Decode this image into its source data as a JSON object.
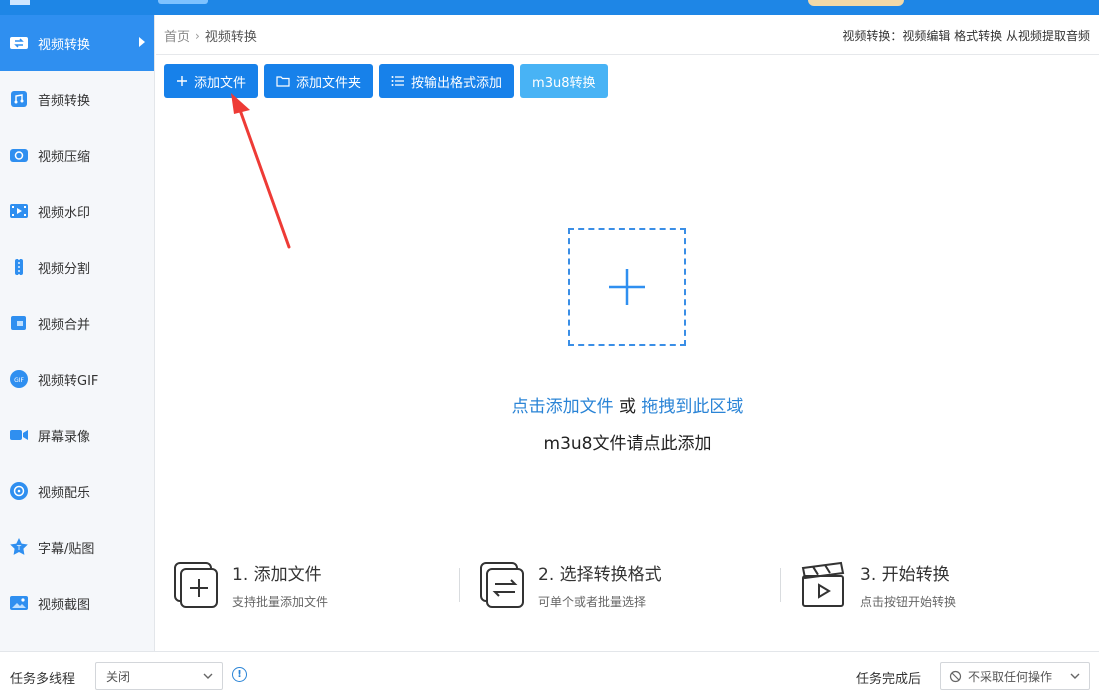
{
  "breadcrumb": {
    "home": "首页",
    "current": "视频转换"
  },
  "header_right": "视频转换：视频编辑 格式转换 从视频提取音频",
  "sidebar": {
    "items": [
      {
        "label": "视频转换",
        "icon": "video-convert-icon",
        "active": true
      },
      {
        "label": "音频转换",
        "icon": "audio-convert-icon"
      },
      {
        "label": "视频压缩",
        "icon": "video-compress-icon"
      },
      {
        "label": "视频水印",
        "icon": "video-watermark-icon"
      },
      {
        "label": "视频分割",
        "icon": "video-split-icon"
      },
      {
        "label": "视频合并",
        "icon": "video-merge-icon"
      },
      {
        "label": "视频转GIF",
        "icon": "video-gif-icon"
      },
      {
        "label": "屏幕录像",
        "icon": "screen-record-icon"
      },
      {
        "label": "视频配乐",
        "icon": "video-music-icon"
      },
      {
        "label": "字幕/贴图",
        "icon": "subtitle-sticker-icon"
      },
      {
        "label": "视频截图",
        "icon": "video-screenshot-icon"
      }
    ]
  },
  "toolbar": {
    "add_file": "添加文件",
    "add_folder": "添加文件夹",
    "add_by_format": "按输出格式添加",
    "m3u8": "m3u8转换"
  },
  "dropzone": {
    "click_add": "点击添加文件",
    "or": " 或 ",
    "drag_here": "拖拽到此区域",
    "m3u8_hint": "m3u8文件请点此添加"
  },
  "steps": [
    {
      "title": "1. 添加文件",
      "desc": "支持批量添加文件"
    },
    {
      "title": "2. 选择转换格式",
      "desc": "可单个或者批量选择"
    },
    {
      "title": "3. 开始转换",
      "desc": "点击按钮开始转换"
    }
  ],
  "bottom": {
    "multithread_label": "任务多线程",
    "multithread_value": "关闭",
    "after_label": "任务完成后",
    "after_value": "不采取任何操作"
  },
  "colors": {
    "primary": "#1781ea",
    "accent_light": "#48b3f5",
    "link": "#2a84d6",
    "annotation": "#ee3b36"
  }
}
